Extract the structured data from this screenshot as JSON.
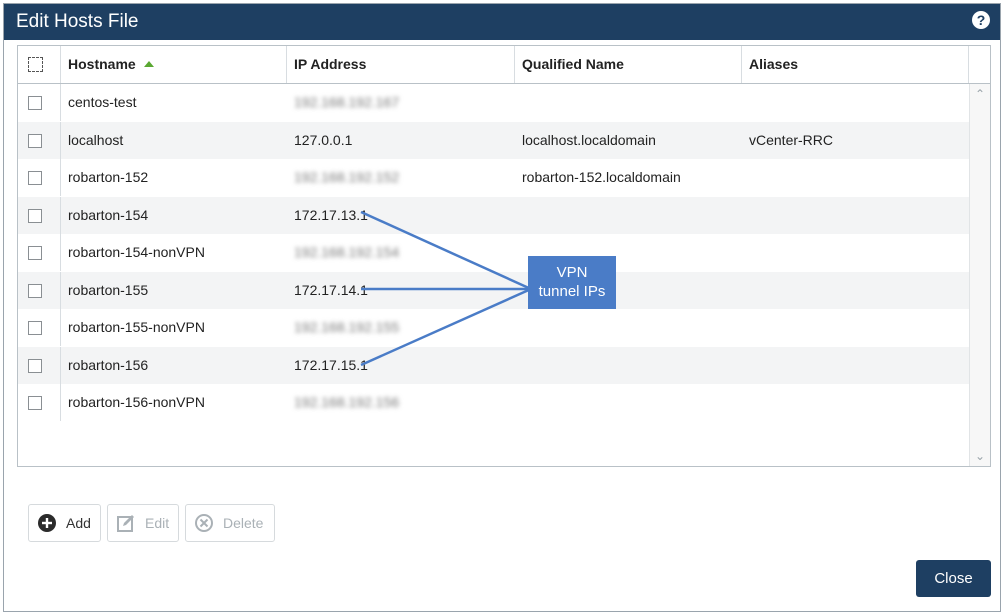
{
  "dialog": {
    "title": "Edit Hosts File",
    "help_icon": "question-circle-icon",
    "help_label": "?"
  },
  "grid": {
    "columns": [
      "Hostname",
      "IP Address",
      "Qualified Name",
      "Aliases"
    ],
    "sort": {
      "column": "Hostname",
      "direction": "ascending"
    },
    "rows": [
      {
        "hostname": "centos-test",
        "ip": "192.168.192.167",
        "qualified": "",
        "aliases": "",
        "ip_redacted": true
      },
      {
        "hostname": "localhost",
        "ip": "127.0.0.1",
        "qualified": "localhost.localdomain",
        "aliases": "vCenter-RRC",
        "ip_redacted": false
      },
      {
        "hostname": "robarton-152",
        "ip": "192.168.192.152",
        "qualified": "robarton-152.localdomain",
        "aliases": "",
        "ip_redacted": true
      },
      {
        "hostname": "robarton-154",
        "ip": "172.17.13.1",
        "qualified": "",
        "aliases": "",
        "ip_redacted": false
      },
      {
        "hostname": "robarton-154-nonVPN",
        "ip": "192.168.192.154",
        "qualified": "",
        "aliases": "",
        "ip_redacted": true
      },
      {
        "hostname": "robarton-155",
        "ip": "172.17.14.1",
        "qualified": "",
        "aliases": "",
        "ip_redacted": false
      },
      {
        "hostname": "robarton-155-nonVPN",
        "ip": "192.168.192.155",
        "qualified": "",
        "aliases": "",
        "ip_redacted": true
      },
      {
        "hostname": "robarton-156",
        "ip": "172.17.15.1",
        "qualified": "",
        "aliases": "",
        "ip_redacted": false
      },
      {
        "hostname": "robarton-156-nonVPN",
        "ip": "192.168.192.156",
        "qualified": "",
        "aliases": "",
        "ip_redacted": true
      }
    ]
  },
  "annotation": {
    "line1": "VPN",
    "line2": "tunnel IPs",
    "color": "#4a7cc7"
  },
  "toolbar": {
    "add_label": "Add",
    "add_icon": "plus-circle-icon",
    "edit_label": "Edit",
    "edit_icon": "edit-icon",
    "delete_label": "Delete",
    "delete_icon": "x-circle-icon"
  },
  "footer": {
    "close_label": "Close"
  },
  "colors": {
    "titlebar": "#1e3f62",
    "accent": "#1e3f62",
    "sort_arrow": "#5aa832"
  }
}
